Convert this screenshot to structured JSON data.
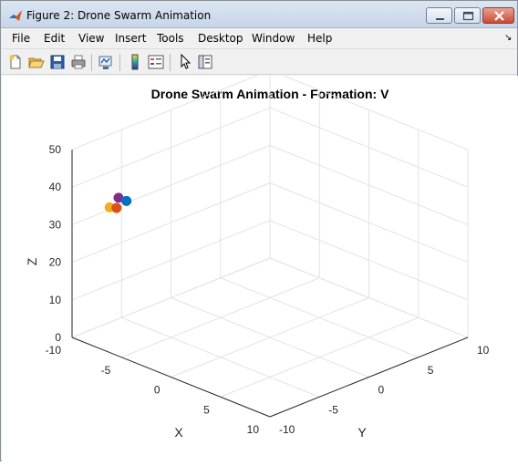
{
  "window": {
    "title": "Figure 2: Drone Swarm Animation"
  },
  "menu": {
    "items": [
      "File",
      "Edit",
      "View",
      "Insert",
      "Tools",
      "Desktop",
      "Window",
      "Help"
    ],
    "overflow_arrow": "↘"
  },
  "toolbar": {
    "icons": [
      "new-figure-icon",
      "open-file-icon",
      "save-icon",
      "print-icon",
      "link-plot-icon",
      "colorbar-icon",
      "legend-icon",
      "pointer-icon",
      "property-editor-icon"
    ]
  },
  "chart_data": {
    "type": "scatter",
    "view": "3d",
    "title": "Drone Swarm Animation - Formation: V",
    "xlabel": "X",
    "ylabel": "Y",
    "zlabel": "Z",
    "xlim": [
      -10,
      10
    ],
    "ylim": [
      -10,
      10
    ],
    "zlim": [
      0,
      50
    ],
    "xticks": [
      "-10",
      "-5",
      "0",
      "5",
      "10"
    ],
    "yticks": [
      "-10",
      "-5",
      "0",
      "5",
      "10"
    ],
    "zticks": [
      "0",
      "10",
      "20",
      "30",
      "40",
      "50"
    ],
    "grid": true,
    "points": [
      {
        "x": -10,
        "y": -6.2,
        "z": 30.6,
        "color": "#EDB120"
      },
      {
        "x": -10,
        "y": -5.3,
        "z": 32.2,
        "color": "#7E2F8E"
      },
      {
        "x": -10,
        "y": -5.5,
        "z": 29.7,
        "color": "#D95319"
      },
      {
        "x": -10,
        "y": -4.5,
        "z": 30.5,
        "color": "#0072BD"
      }
    ]
  }
}
